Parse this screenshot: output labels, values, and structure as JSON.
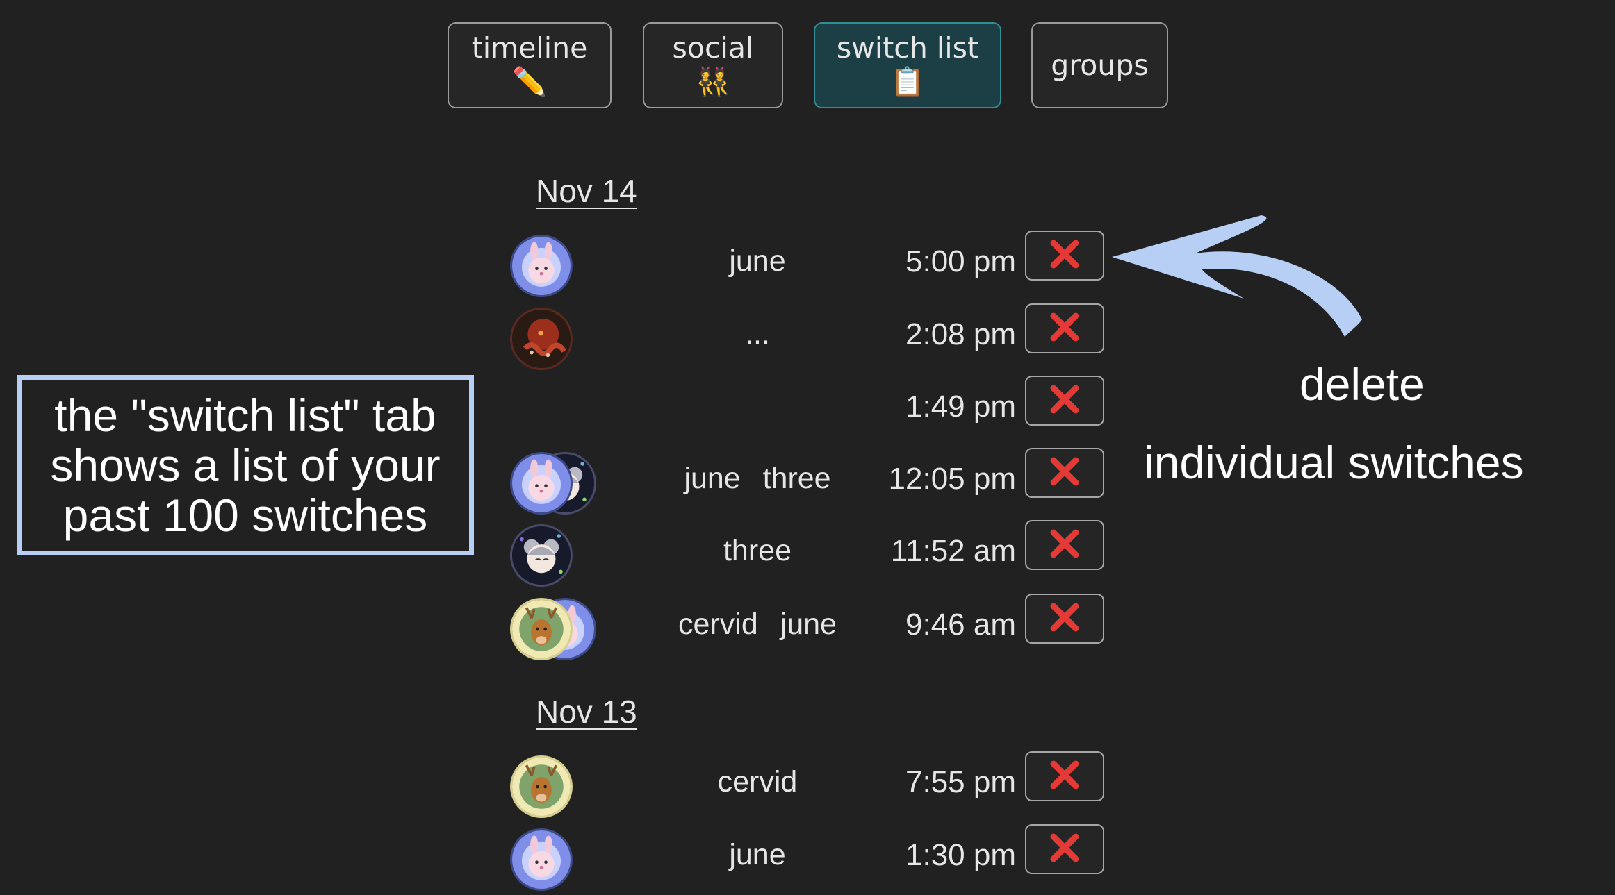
{
  "tabs": [
    {
      "label": "timeline",
      "emoji": "✏️"
    },
    {
      "label": "social",
      "emoji": "👯"
    },
    {
      "label": "switch list",
      "emoji": "📋"
    },
    {
      "label": "groups",
      "emoji": ""
    }
  ],
  "active_tab": "switch list",
  "days": [
    {
      "date": "Nov 14",
      "switches": [
        {
          "name": "june",
          "time": "5:00 pm",
          "avatars": [
            "bunny"
          ],
          "delete_icon": "red-x-icon"
        },
        {
          "name": "...",
          "time": "2:08 pm",
          "avatars": [
            "octopus"
          ],
          "delete_icon": "red-x-icon"
        },
        {
          "name": "",
          "time": "1:49 pm",
          "avatars": [],
          "delete_icon": "red-x-icon"
        },
        {
          "name": "june  three",
          "time": "12:05 pm",
          "avatars": [
            "bunny",
            "mouse-girl"
          ],
          "delete_icon": "red-x-icon"
        },
        {
          "name": "three",
          "time": "11:52 am",
          "avatars": [
            "mouse-girl"
          ],
          "delete_icon": "red-x-icon"
        },
        {
          "name": "cervid  june",
          "time": "9:46 am",
          "avatars": [
            "deer",
            "bunny"
          ],
          "delete_icon": "red-x-icon"
        }
      ]
    },
    {
      "date": "Nov 13",
      "switches": [
        {
          "name": "cervid",
          "time": "7:55 pm",
          "avatars": [
            "deer"
          ],
          "delete_icon": "red-x-icon"
        },
        {
          "name": "june",
          "time": "1:30 pm",
          "avatars": [
            "bunny"
          ],
          "delete_icon": "red-x-icon"
        }
      ]
    }
  ],
  "callout": {
    "text_lines": [
      "the \"switch list\" tab",
      "shows a list of your",
      "past 100 switches"
    ]
  },
  "annotation": {
    "line1": "delete",
    "line2": "individual switches",
    "arrow_color": "#b8cff5"
  },
  "colors": {
    "background": "#212121",
    "active_tab": "#1c3f45",
    "delete_x": "#e53935",
    "callout_border": "#b8cff5"
  }
}
